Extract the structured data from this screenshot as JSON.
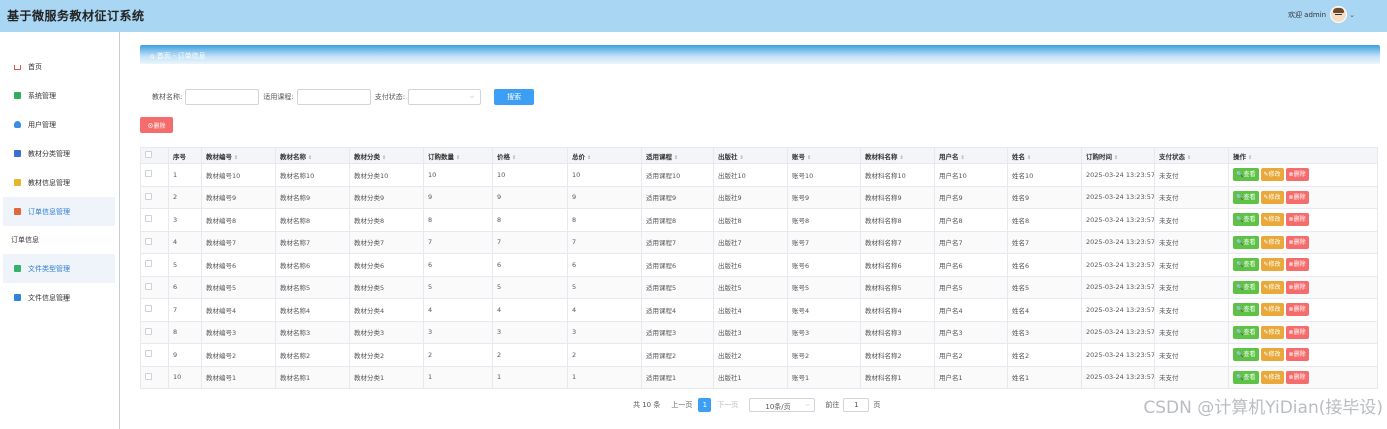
{
  "app_title": "基于微服务教材征订系统",
  "user": {
    "welcome": "欢迎 admin"
  },
  "sidebar": {
    "items": [
      {
        "label": "首页",
        "icon": "home-icon"
      },
      {
        "label": "系统管理",
        "icon": "system-icon"
      },
      {
        "label": "用户管理",
        "icon": "user-icon"
      },
      {
        "label": "教材分类管理",
        "icon": "category-icon"
      },
      {
        "label": "教材信息管理",
        "icon": "book-icon"
      },
      {
        "label": "订单信息管理",
        "icon": "order-icon"
      },
      {
        "label": "订单信息",
        "icon": ""
      },
      {
        "label": "文件类型管理",
        "icon": "file-type-icon"
      },
      {
        "label": "文件信息管理",
        "icon": "file-info-icon"
      }
    ]
  },
  "breadcrumb": {
    "home": "首页",
    "sep": "-",
    "current": "订单信息"
  },
  "search": {
    "label1": "教材名称:",
    "label2": "适用课程:",
    "label3": "支付状态:",
    "button": "搜索"
  },
  "toolbar": {
    "delete": "删除"
  },
  "table": {
    "headers": [
      "序号",
      "教材编号",
      "教材名称",
      "教材分类",
      "订购数量",
      "价格",
      "总价",
      "适用课程",
      "出版社",
      "账号",
      "教材科名称",
      "用户名",
      "姓名",
      "订购时间",
      "支付状态",
      "操作"
    ],
    "actions": {
      "view": "查看",
      "edit": "修改",
      "del": "删除"
    },
    "rows": [
      [
        "1",
        "教材编号10",
        "教材名称10",
        "教材分类10",
        "10",
        "10",
        "10",
        "适用课程10",
        "出版社10",
        "账号10",
        "教材科名称10",
        "用户名10",
        "姓名10",
        "2025-03-24 13:23:57",
        "未支付"
      ],
      [
        "2",
        "教材编号9",
        "教材名称9",
        "教材分类9",
        "9",
        "9",
        "9",
        "适用课程9",
        "出版社9",
        "账号9",
        "教材科名称9",
        "用户名9",
        "姓名9",
        "2025-03-24 13:23:57",
        "未支付"
      ],
      [
        "3",
        "教材编号8",
        "教材名称8",
        "教材分类8",
        "8",
        "8",
        "8",
        "适用课程8",
        "出版社8",
        "账号8",
        "教材科名称8",
        "用户名8",
        "姓名8",
        "2025-03-24 13:23:57",
        "未支付"
      ],
      [
        "4",
        "教材编号7",
        "教材名称7",
        "教材分类7",
        "7",
        "7",
        "7",
        "适用课程7",
        "出版社7",
        "账号7",
        "教材科名称7",
        "用户名7",
        "姓名7",
        "2025-03-24 13:23:57",
        "未支付"
      ],
      [
        "5",
        "教材编号6",
        "教材名称6",
        "教材分类6",
        "6",
        "6",
        "6",
        "适用课程6",
        "出版社6",
        "账号6",
        "教材科名称6",
        "用户名6",
        "姓名6",
        "2025-03-24 13:23:57",
        "未支付"
      ],
      [
        "6",
        "教材编号5",
        "教材名称5",
        "教材分类5",
        "5",
        "5",
        "5",
        "适用课程5",
        "出版社5",
        "账号5",
        "教材科名称5",
        "用户名5",
        "姓名5",
        "2025-03-24 13:23:57",
        "未支付"
      ],
      [
        "7",
        "教材编号4",
        "教材名称4",
        "教材分类4",
        "4",
        "4",
        "4",
        "适用课程4",
        "出版社4",
        "账号4",
        "教材科名称4",
        "用户名4",
        "姓名4",
        "2025-03-24 13:23:57",
        "未支付"
      ],
      [
        "8",
        "教材编号3",
        "教材名称3",
        "教材分类3",
        "3",
        "3",
        "3",
        "适用课程3",
        "出版社3",
        "账号3",
        "教材科名称3",
        "用户名3",
        "姓名3",
        "2025-03-24 13:23:57",
        "未支付"
      ],
      [
        "9",
        "教材编号2",
        "教材名称2",
        "教材分类2",
        "2",
        "2",
        "2",
        "适用课程2",
        "出版社2",
        "账号2",
        "教材科名称2",
        "用户名2",
        "姓名2",
        "2025-03-24 13:23:57",
        "未支付"
      ],
      [
        "10",
        "教材编号1",
        "教材名称1",
        "教材分类1",
        "1",
        "1",
        "1",
        "适用课程1",
        "出版社1",
        "账号1",
        "教材科名称1",
        "用户名1",
        "姓名1",
        "2025-03-24 13:23:57",
        "未支付"
      ]
    ]
  },
  "pagination": {
    "total": "共 10 条",
    "prev": "上一页",
    "current": "1",
    "next": "下一页",
    "page_size": "10条/页",
    "goto": "前往",
    "goto_value": "1",
    "page_unit": "页"
  },
  "watermark": "CSDN @计算机YiDian(接毕设)",
  "colors": {
    "topbar": "#a9d6f3",
    "primary": "#3c9ef5",
    "danger": "#f46c6c",
    "view": "#5ec246",
    "edit": "#e8a93a"
  }
}
